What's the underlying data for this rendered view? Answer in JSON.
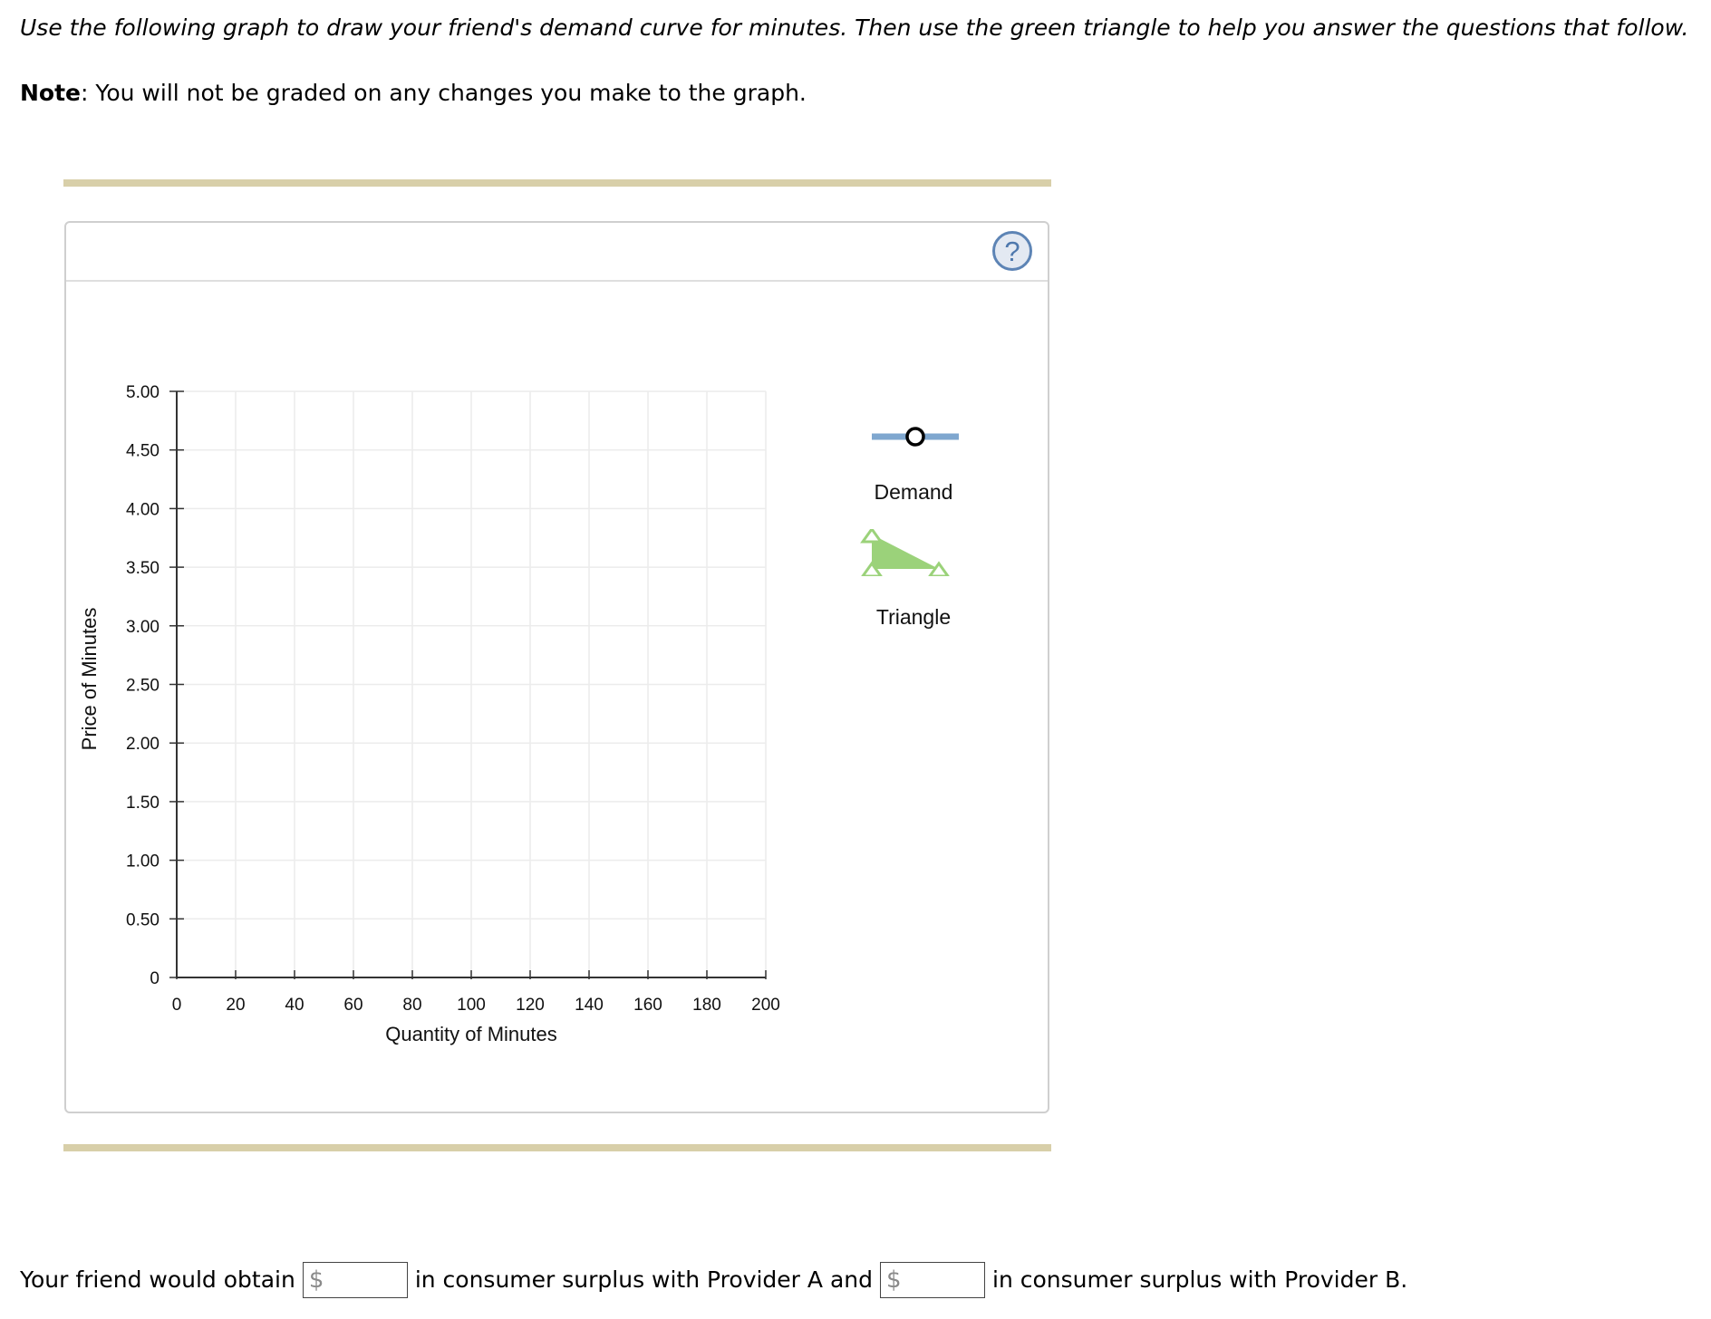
{
  "instructions": "Use the following graph to draw your friend's demand curve for minutes. Then use the green triangle to help you answer the questions that follow.",
  "note": {
    "label": "Note",
    "text": ": You will not be graded on any changes you make to the graph."
  },
  "help_button": {
    "symbol": "?"
  },
  "chart_data": {
    "type": "line",
    "series": [],
    "xlabel": "Quantity of Minutes",
    "ylabel": "Price of Minutes",
    "xlim": [
      0,
      200
    ],
    "ylim": [
      0,
      5
    ],
    "xticks": [
      "0",
      "20",
      "40",
      "60",
      "80",
      "100",
      "120",
      "140",
      "160",
      "180",
      "200"
    ],
    "yticks": [
      "0",
      "0.50",
      "1.00",
      "1.50",
      "2.00",
      "2.50",
      "3.00",
      "3.50",
      "4.00",
      "4.50",
      "5.00"
    ],
    "grid": true
  },
  "tools": {
    "demand": {
      "label": "Demand",
      "color": "#7fa7cf"
    },
    "triangle": {
      "label": "Triangle",
      "color": "#9bd27a"
    }
  },
  "answer": {
    "prefix": "Your friend would obtain",
    "middle": "in consumer surplus with Provider A and",
    "suffix": "in consumer surplus with Provider B.",
    "currency": "$",
    "provider_a_value": "",
    "provider_b_value": ""
  }
}
